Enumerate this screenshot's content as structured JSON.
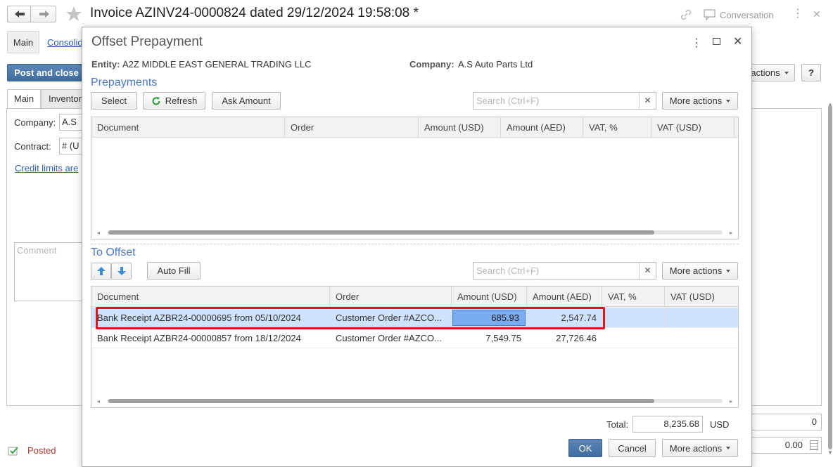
{
  "window": {
    "title": "Invoice AZINV24-0000824 dated 29/12/2024 19:58:08 *",
    "conversation_label": "Conversation"
  },
  "background": {
    "tab_main": "Main",
    "tab_consolid": "Consolid",
    "post_and_close": "Post and close",
    "more_actions_partial": "actions",
    "help": "?",
    "inner_tab_main": "Main",
    "inner_tab_inventory": "Inventory",
    "company_label": "Company:",
    "company_value": "A.S A",
    "contract_label": "Contract:",
    "contract_value": "# (U",
    "credit_limits_link": "Credit limits are",
    "comment_placeholder": "Comment",
    "status": "Posted",
    "right_value_1": "0",
    "right_value_2": "0.00"
  },
  "dialog": {
    "title": "Offset Prepayment",
    "entity_label": "Entity:",
    "entity_value": "A2Z MIDDLE EAST GENERAL TRADING LLC",
    "company_label": "Company:",
    "company_value": "A.S Auto Parts Ltd",
    "prepayments": {
      "section_title": "Prepayments",
      "select_label": "Select",
      "refresh_label": "Refresh",
      "ask_amount_label": "Ask Amount",
      "search_placeholder": "Search (Ctrl+F)",
      "more_actions_label": "More actions",
      "columns": [
        "Document",
        "Order",
        "Amount (USD)",
        "Amount (AED)",
        "VAT, %",
        "VAT (USD)"
      ]
    },
    "to_offset": {
      "section_title": "To Offset",
      "auto_fill_label": "Auto Fill",
      "search_placeholder": "Search (Ctrl+F)",
      "more_actions_label": "More actions",
      "columns": [
        "Document",
        "Order",
        "Amount (USD)",
        "Amount (AED)",
        "VAT, %",
        "VAT (USD)"
      ],
      "rows": [
        {
          "document": "Bank Receipt AZBR24-00000695 from 05/10/2024",
          "order": "Customer Order #AZCO...",
          "amount_usd": "685.93",
          "amount_aed": "2,547.74",
          "vat_pct": "",
          "vat_usd": ""
        },
        {
          "document": "Bank Receipt AZBR24-00000857 from 18/12/2024",
          "order": "Customer Order #AZCO...",
          "amount_usd": "7,549.75",
          "amount_aed": "27,726.46",
          "vat_pct": "",
          "vat_usd": ""
        }
      ]
    },
    "total_label": "Total:",
    "total_value": "8,235.68",
    "currency": "USD",
    "ok_label": "OK",
    "cancel_label": "Cancel",
    "more_actions_label": "More actions"
  },
  "colors": {
    "accent_blue": "#4a78c4",
    "selected_row": "#cfe2fb",
    "selected_cell": "#7aaaf0",
    "highlight_border": "#e0151c"
  }
}
